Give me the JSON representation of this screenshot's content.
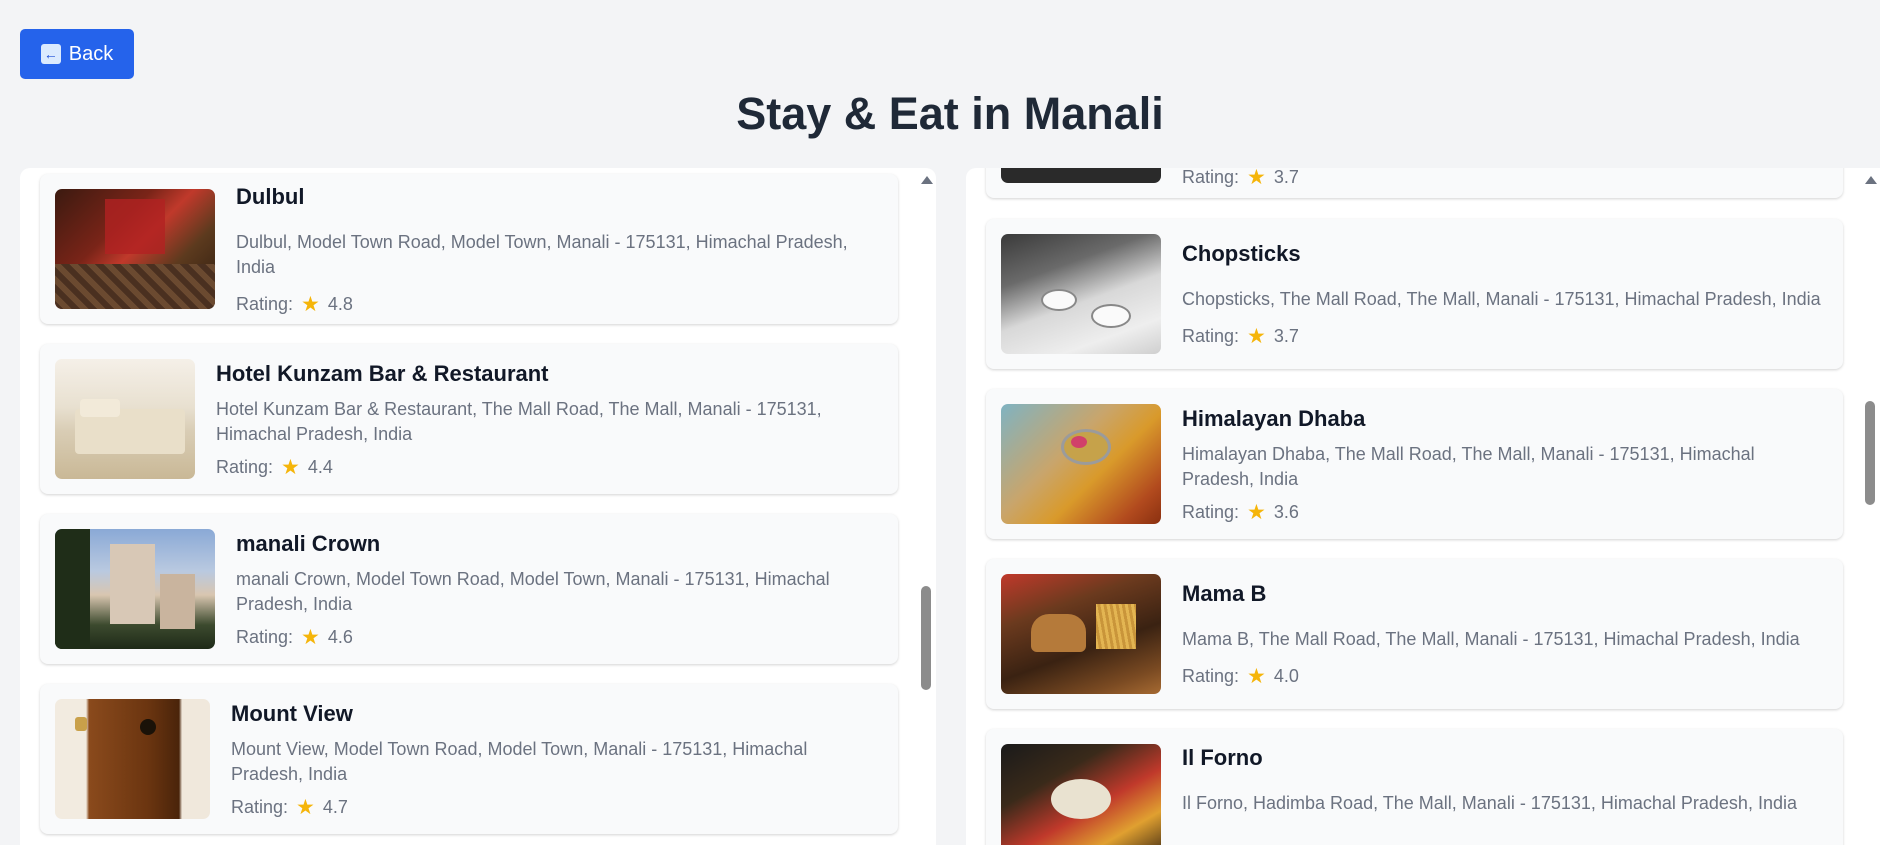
{
  "header": {
    "back_label": "Back",
    "title": "Stay & Eat in Manali"
  },
  "hotels": [
    {
      "name": "Dulbul",
      "address": "Dulbul, Model Town Road, Model Town, Manali - 175131, Himachal Pradesh, India",
      "rating_label": "Rating:",
      "rating": "4.8"
    },
    {
      "name": "Hotel Kunzam Bar & Restaurant",
      "address": "Hotel Kunzam Bar & Restaurant, The Mall Road, The Mall, Manali - 175131, Himachal Pradesh, India",
      "rating_label": "Rating:",
      "rating": "4.4"
    },
    {
      "name": "manali Crown",
      "address": "manali Crown, Model Town Road, Model Town, Manali - 175131, Himachal Pradesh, India",
      "rating_label": "Rating:",
      "rating": "4.6"
    },
    {
      "name": "Mount View",
      "address": "Mount View, Model Town Road, Model Town, Manali - 175131, Himachal Pradesh, India",
      "rating_label": "Rating:",
      "rating": "4.7"
    }
  ],
  "restaurants": [
    {
      "partial_rating_label": "Rating:",
      "partial_rating": "3.7"
    },
    {
      "name": "Chopsticks",
      "address": "Chopsticks, The Mall Road, The Mall, Manali - 175131, Himachal Pradesh, India",
      "rating_label": "Rating:",
      "rating": "3.7"
    },
    {
      "name": "Himalayan Dhaba",
      "address": "Himalayan Dhaba, The Mall Road, The Mall, Manali - 175131, Himachal Pradesh, India",
      "rating_label": "Rating:",
      "rating": "3.6"
    },
    {
      "name": "Mama B",
      "address": "Mama B, The Mall Road, The Mall, Manali - 175131, Himachal Pradesh, India",
      "rating_label": "Rating:",
      "rating": "4.0"
    },
    {
      "name": "Il Forno",
      "address": "Il Forno, Hadimba Road, The Mall, Manali - 175131, Himachal Pradesh, India"
    }
  ],
  "colors": {
    "accent": "#2563eb",
    "star": "#f5b50a"
  }
}
